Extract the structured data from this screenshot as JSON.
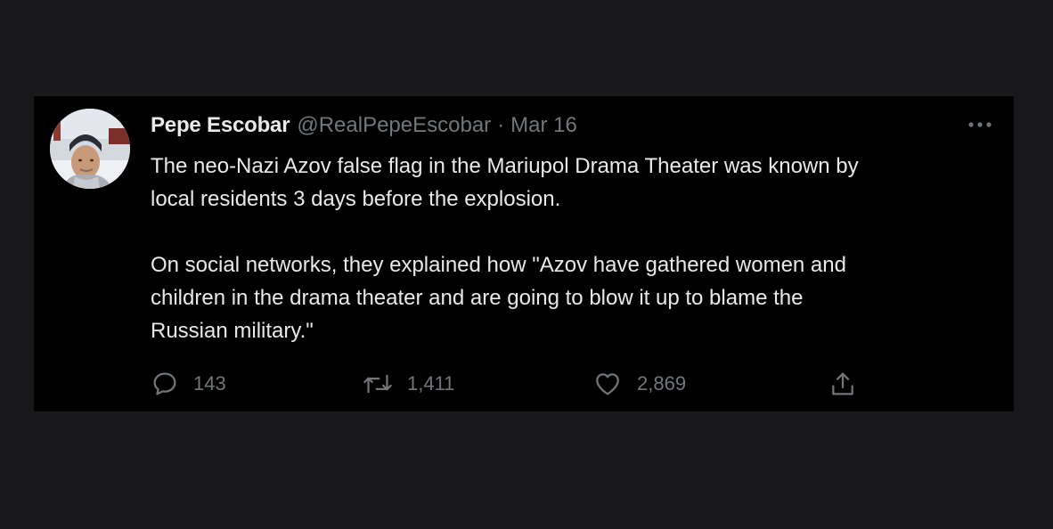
{
  "tweet": {
    "author": {
      "name": "Pepe Escobar",
      "handle": "@RealPepeEscobar",
      "separator": "·",
      "date": "Mar 16"
    },
    "text_paragraphs": [
      "The neo-Nazi Azov false flag in the Mariupol Drama Theater was known by\nlocal residents 3 days before the explosion.",
      "On social networks, they explained how \"Azov have gathered women and\nchildren in the drama theater and are going to blow it up to blame the\nRussian military.\""
    ],
    "actions": {
      "reply_count": "143",
      "retweet_count": "1,411",
      "like_count": "2,869"
    },
    "icons": {
      "more": "more-horizontal-icon",
      "reply": "reply-bubble-icon",
      "retweet": "retweet-arrows-icon",
      "like": "heart-icon",
      "share": "share-upload-icon"
    }
  },
  "colors": {
    "page_background": "#18181a",
    "card_background": "#000000",
    "primary_text": "#e7e9ea",
    "secondary_text": "#71767b"
  }
}
